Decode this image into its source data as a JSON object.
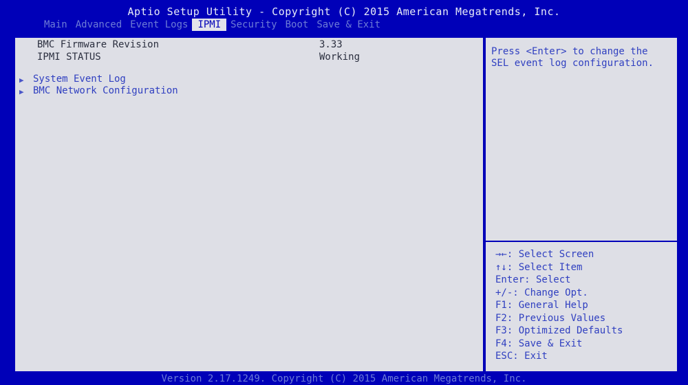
{
  "header": {
    "title": "Aptio Setup Utility - Copyright (C) 2015 American Megatrends, Inc."
  },
  "tabs": [
    {
      "label": "Main"
    },
    {
      "label": "Advanced"
    },
    {
      "label": "Event Logs"
    },
    {
      "label": "IPMI"
    },
    {
      "label": "Security"
    },
    {
      "label": "Boot"
    },
    {
      "label": "Save & Exit"
    }
  ],
  "main": {
    "rows": [
      {
        "label": "BMC Firmware Revision",
        "value": "3.33"
      },
      {
        "label": "IPMI STATUS",
        "value": "Working"
      }
    ],
    "links": [
      {
        "label": "System Event Log"
      },
      {
        "label": "BMC Network Configuration"
      }
    ]
  },
  "help": {
    "text": "Press <Enter> to change the\nSEL event log configuration."
  },
  "keys": [
    "→←: Select Screen",
    "↑↓: Select Item",
    "Enter: Select",
    "+/-: Change Opt.",
    "F1: General Help",
    "F2: Previous Values",
    "F3: Optimized Defaults",
    "F4: Save & Exit",
    "ESC: Exit"
  ],
  "footer": {
    "text": "Version 2.17.1249. Copyright (C) 2015 American Megatrends, Inc."
  }
}
